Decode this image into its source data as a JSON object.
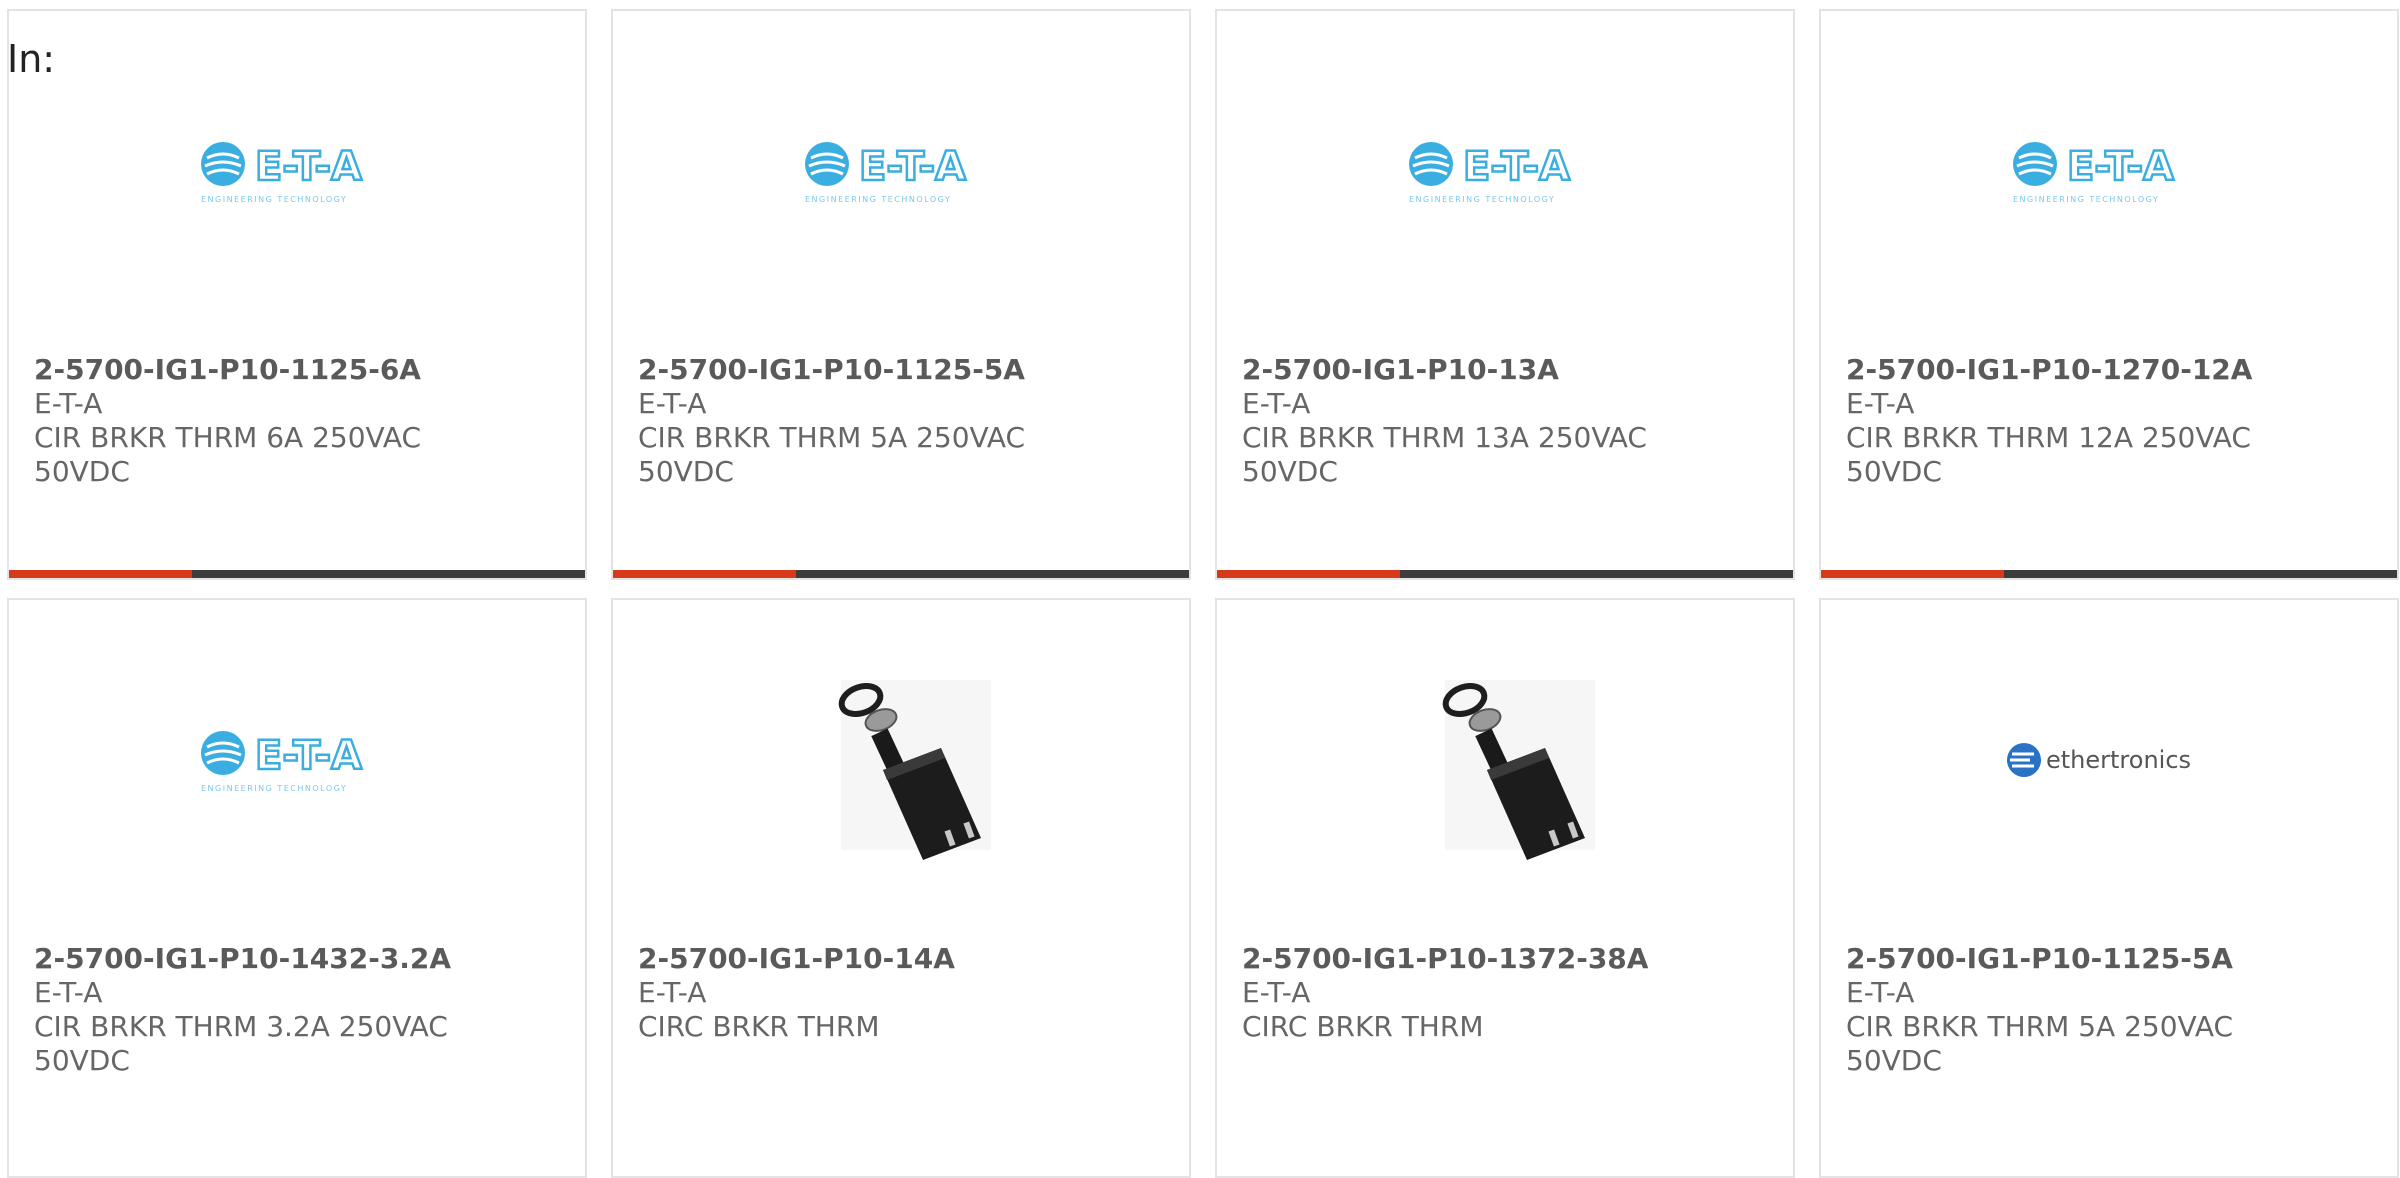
{
  "header": {
    "label": "In:"
  },
  "colors": {
    "accent": "#d63a1a",
    "bar": "#3d3d3d",
    "logo_blue": "#3aaee0"
  },
  "logos": {
    "eta_text": "E-T-A",
    "eta_tagline": "ENGINEERING TECHNOLOGY",
    "ethertronics_text": "ethertronics"
  },
  "products": [
    {
      "part_number": "2-5700-IG1-P10-1125-6A",
      "manufacturer": "E-T-A",
      "desc1": "CIR BRKR THRM 6A 250VAC",
      "desc2": "50VDC",
      "image": "eta-logo"
    },
    {
      "part_number": "2-5700-IG1-P10-1125-5A",
      "manufacturer": "E-T-A",
      "desc1": "CIR BRKR THRM 5A 250VAC",
      "desc2": "50VDC",
      "image": "eta-logo"
    },
    {
      "part_number": "2-5700-IG1-P10-13A",
      "manufacturer": "E-T-A",
      "desc1": "CIR BRKR THRM 13A 250VAC",
      "desc2": "50VDC",
      "image": "eta-logo"
    },
    {
      "part_number": "2-5700-IG1-P10-1270-12A",
      "manufacturer": "E-T-A",
      "desc1": "CIR BRKR THRM 12A 250VAC",
      "desc2": "50VDC",
      "image": "eta-logo"
    },
    {
      "part_number": "2-5700-IG1-P10-1432-3.2A",
      "manufacturer": "E-T-A",
      "desc1": "CIR BRKR THRM 3.2A 250VAC",
      "desc2": "50VDC",
      "image": "eta-logo"
    },
    {
      "part_number": "2-5700-IG1-P10-14A",
      "manufacturer": "E-T-A",
      "desc1": "CIRC BRKR THRM",
      "desc2": "",
      "image": "breaker-photo"
    },
    {
      "part_number": "2-5700-IG1-P10-1372-38A",
      "manufacturer": "E-T-A",
      "desc1": "CIRC BRKR THRM",
      "desc2": "",
      "image": "breaker-photo"
    },
    {
      "part_number": "2-5700-IG1-P10-1125-5A",
      "manufacturer": "E-T-A",
      "desc1": "CIR BRKR THRM 5A 250VAC",
      "desc2": "50VDC",
      "image": "ethertronics-logo"
    }
  ]
}
